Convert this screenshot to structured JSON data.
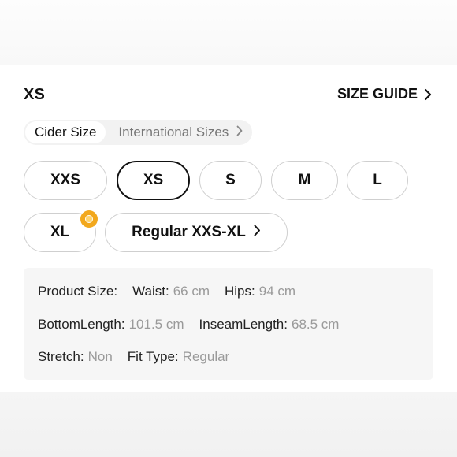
{
  "header": {
    "selected_size": "XS",
    "size_guide_label": "SIZE GUIDE"
  },
  "size_system": {
    "active": "Cider Size",
    "inactive": "International Sizes"
  },
  "sizes": [
    {
      "label": "XXS",
      "selected": false
    },
    {
      "label": "XS",
      "selected": true
    },
    {
      "label": "S",
      "selected": false
    },
    {
      "label": "M",
      "selected": false
    },
    {
      "label": "L",
      "selected": false
    },
    {
      "label": "XL",
      "selected": false,
      "badge": true
    },
    {
      "label": "Regular XXS-XL",
      "selected": false,
      "has_chevron": true
    }
  ],
  "product_size": {
    "title": "Product Size:",
    "waist": {
      "label": "Waist:",
      "value": "66 cm"
    },
    "hips": {
      "label": "Hips:",
      "value": "94 cm"
    },
    "bottom_length": {
      "label": "BottomLength:",
      "value": "101.5 cm"
    },
    "inseam_length": {
      "label": "InseamLength:",
      "value": "68.5 cm"
    },
    "stretch": {
      "label": "Stretch:",
      "value": "Non"
    },
    "fit_type": {
      "label": "Fit Type:",
      "value": "Regular"
    }
  },
  "colors": {
    "badge": "#f2a81d",
    "selected_border": "#111111",
    "pill_border": "#cfcfcf",
    "muted_text": "#9a9a9a"
  },
  "icons": {
    "size_guide": "chevron-right-icon",
    "international_sizes": "chevron-right-icon",
    "regular_range": "chevron-right-icon",
    "xl_badge": "coin-badge-icon"
  }
}
